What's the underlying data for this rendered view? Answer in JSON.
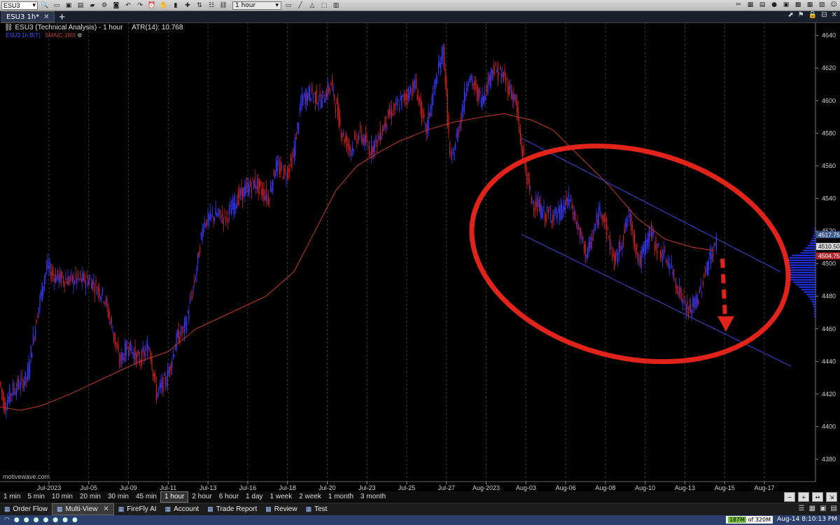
{
  "toolbar": {
    "symbol": "ESU3",
    "timeframe": "1 hour"
  },
  "tabs": {
    "active": "ESU3 1h*",
    "add": "+"
  },
  "chart": {
    "title": "ESU3 (Technical Analysis) - 1 hour",
    "atr_label": "ATR(14): 10.768",
    "legend_blue": "ESU3 1h B(T)",
    "legend_sma": "SMA(C,180)",
    "watermark": "motivewave.com",
    "colors": {
      "up": "#3a3aff",
      "down": "#d02020",
      "sma": "#c83828",
      "channel": "#3b45e0",
      "annotation": "#e2231a"
    }
  },
  "chart_data": {
    "type": "candlestick",
    "y_ticks": [
      4380,
      4400,
      4420,
      4440,
      4460,
      4480,
      4500,
      4520,
      4540,
      4560,
      4580,
      4600,
      4620,
      4640
    ],
    "ylim": [
      4368,
      4648
    ],
    "x_labels": [
      "Jul-2023",
      "Jul-05",
      "Jul-09",
      "Jul-11",
      "Jul-13",
      "Jul-16",
      "Jul-18",
      "Jul-20",
      "Jul-23",
      "Jul-25",
      "Jul-27",
      "Aug-2023",
      "Aug-03",
      "Aug-06",
      "Aug-08",
      "Aug-10",
      "Aug-13",
      "Aug-15",
      "Aug-17"
    ],
    "price_tags": [
      {
        "value": 4517.75,
        "label": "4517.75",
        "color": "#3c5a8c"
      },
      {
        "value": 4510.5,
        "label": "4510.50",
        "color": "#dddddd"
      },
      {
        "value": 4504.75,
        "label": "4504.75",
        "color": "#b3282d"
      }
    ],
    "price_path": [
      [
        0,
        4430
      ],
      [
        8,
        4412
      ],
      [
        18,
        4422
      ],
      [
        40,
        4430
      ],
      [
        55,
        4470
      ],
      [
        68,
        4498
      ],
      [
        80,
        4492
      ],
      [
        100,
        4490
      ],
      [
        130,
        4490
      ],
      [
        150,
        4480
      ],
      [
        162,
        4460
      ],
      [
        172,
        4440
      ],
      [
        185,
        4450
      ],
      [
        200,
        4440
      ],
      [
        215,
        4450
      ],
      [
        225,
        4420
      ],
      [
        240,
        4430
      ],
      [
        255,
        4455
      ],
      [
        265,
        4460
      ],
      [
        280,
        4490
      ],
      [
        292,
        4525
      ],
      [
        310,
        4530
      ],
      [
        325,
        4528
      ],
      [
        340,
        4540
      ],
      [
        352,
        4545
      ],
      [
        365,
        4550
      ],
      [
        385,
        4540
      ],
      [
        395,
        4560
      ],
      [
        410,
        4555
      ],
      [
        420,
        4565
      ],
      [
        432,
        4600
      ],
      [
        445,
        4605
      ],
      [
        460,
        4600
      ],
      [
        475,
        4610
      ],
      [
        490,
        4580
      ],
      [
        502,
        4570
      ],
      [
        515,
        4580
      ],
      [
        530,
        4570
      ],
      [
        540,
        4575
      ],
      [
        555,
        4590
      ],
      [
        565,
        4595
      ],
      [
        575,
        4600
      ],
      [
        595,
        4610
      ],
      [
        610,
        4580
      ],
      [
        618,
        4600
      ],
      [
        635,
        4632
      ],
      [
        645,
        4560
      ],
      [
        660,
        4590
      ],
      [
        670,
        4615
      ],
      [
        690,
        4600
      ],
      [
        705,
        4620
      ],
      [
        720,
        4615
      ],
      [
        738,
        4600
      ],
      [
        745,
        4575
      ],
      [
        760,
        4540
      ],
      [
        780,
        4530
      ],
      [
        800,
        4530
      ],
      [
        815,
        4540
      ],
      [
        828,
        4520
      ],
      [
        840,
        4505
      ],
      [
        860,
        4535
      ],
      [
        880,
        4500
      ],
      [
        900,
        4530
      ],
      [
        915,
        4500
      ],
      [
        930,
        4520
      ],
      [
        940,
        4510
      ],
      [
        958,
        4500
      ],
      [
        970,
        4485
      ],
      [
        985,
        4470
      ],
      [
        1000,
        4480
      ],
      [
        1012,
        4500
      ],
      [
        1025,
        4513
      ]
    ],
    "sma_path": [
      [
        0,
        4412
      ],
      [
        30,
        4410
      ],
      [
        60,
        4413
      ],
      [
        100,
        4420
      ],
      [
        150,
        4430
      ],
      [
        200,
        4440
      ],
      [
        240,
        4446
      ],
      [
        280,
        4460
      ],
      [
        330,
        4470
      ],
      [
        380,
        4480
      ],
      [
        420,
        4495
      ],
      [
        450,
        4520
      ],
      [
        480,
        4545
      ],
      [
        510,
        4560
      ],
      [
        540,
        4568
      ],
      [
        570,
        4575
      ],
      [
        610,
        4582
      ],
      [
        650,
        4587
      ],
      [
        690,
        4590
      ],
      [
        720,
        4592
      ],
      [
        760,
        4588
      ],
      [
        790,
        4582
      ],
      [
        830,
        4565
      ],
      [
        870,
        4548
      ],
      [
        910,
        4528
      ],
      [
        950,
        4515
      ],
      [
        990,
        4510
      ],
      [
        1020,
        4508
      ]
    ],
    "channel_upper": [
      [
        745,
        4577
      ],
      [
        1115,
        4495
      ]
    ],
    "channel_lower": [
      [
        745,
        4518
      ],
      [
        1130,
        4437
      ]
    ],
    "annotation": {
      "ellipse_center": [
        900,
        4506
      ],
      "dashed_arrow_from": [
        1032,
        4503
      ],
      "dashed_arrow_to": [
        1032,
        4460
      ]
    }
  },
  "timeframes": [
    "1 min",
    "5 min",
    "10 min",
    "20 min",
    "30 min",
    "45 min",
    "1 hour",
    "2 hour",
    "6 hour",
    "1 day",
    "1 week",
    "2 week",
    "1 month",
    "3 month"
  ],
  "active_timeframe": "1 hour",
  "panels": [
    {
      "label": "Order Flow",
      "icon": "order-flow-icon"
    },
    {
      "label": "Multi-View",
      "icon": "multi-view-icon",
      "active": true,
      "close": "x"
    },
    {
      "label": "FireFly AI",
      "icon": "firefly-icon"
    },
    {
      "label": "Account",
      "icon": "account-icon"
    },
    {
      "label": "Trade Report",
      "icon": "trade-report-icon"
    },
    {
      "label": "Review",
      "icon": "review-icon"
    },
    {
      "label": "Test",
      "icon": "test-icon"
    }
  ],
  "status": {
    "memory_used": "187M",
    "memory_rest": "of 320M",
    "clock": "Aug-14 8:10:13 PM"
  }
}
